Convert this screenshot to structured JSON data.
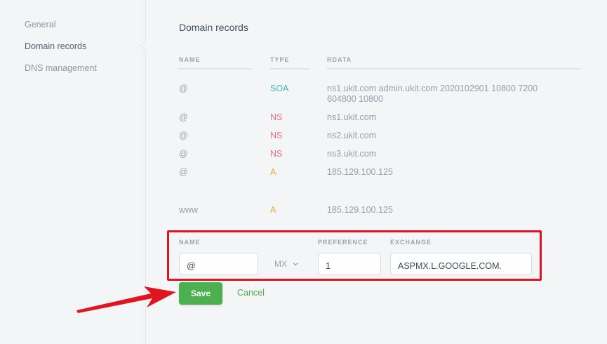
{
  "sidebar": {
    "items": [
      {
        "label": "General"
      },
      {
        "label": "Domain records"
      },
      {
        "label": "DNS management"
      }
    ]
  },
  "main": {
    "title": "Domain records",
    "columns": {
      "name": "NAME",
      "type": "TYPE",
      "rdata": "RDATA"
    },
    "records": [
      {
        "name": "@",
        "type": "SOA",
        "rdata_line1": "ns1.ukit.com admin.ukit.com 2020102901 10800 7200",
        "rdata_line2": "604800 10800"
      },
      {
        "name": "@",
        "type": "NS",
        "rdata": "ns1.ukit.com"
      },
      {
        "name": "@",
        "type": "NS",
        "rdata": "ns2.ukit.com"
      },
      {
        "name": "@",
        "type": "NS",
        "rdata": "ns3.ukit.com"
      },
      {
        "name": "@",
        "type": "A",
        "rdata": "185.129.100.125"
      },
      {
        "name": "www",
        "type": "A",
        "rdata": "185.129.100.125"
      }
    ]
  },
  "form": {
    "labels": {
      "name": "NAME",
      "preference": "PREFERENCE",
      "exchange": "EXCHANGE"
    },
    "name_value": "@",
    "type_value": "MX",
    "preference_value": "1",
    "exchange_value": "ASPMX.L.GOOGLE.COM.",
    "save_label": "Save",
    "cancel_label": "Cancel"
  },
  "colors": {
    "soa": "#3bbfad",
    "ns": "#ef6d7c",
    "a": "#f0a93a",
    "save": "#4caf50",
    "highlight": "#e0151f"
  },
  "icons": {
    "type_dropdown": "chevron-down-icon",
    "annotation": "red-arrow-icon"
  }
}
